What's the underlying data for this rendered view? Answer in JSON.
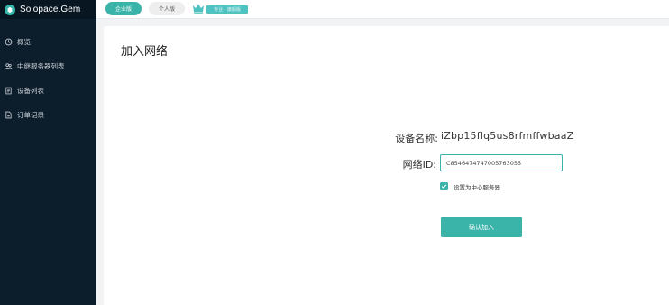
{
  "brand": {
    "name": "Solopace.Gem",
    "icon": "logo-icon"
  },
  "sidebar": {
    "items": [
      {
        "label": "概览",
        "icon": "dashboard-icon"
      },
      {
        "label": "中继服务器列表",
        "icon": "server-cluster-icon"
      },
      {
        "label": "设备列表",
        "icon": "device-list-icon"
      },
      {
        "label": "订单记录",
        "icon": "order-record-icon"
      }
    ]
  },
  "topbar": {
    "enterprise_label": "企业版",
    "personal_label": "个人版",
    "edition_badge": "专业 · 旗舰版",
    "crown_icon": "crown-icon"
  },
  "page": {
    "title": "加入网络",
    "device_name_label": "设备名称:",
    "device_name_value": "iZbp15flq5us8rfmffwbaaZ",
    "network_id_label": "网络ID:",
    "network_id_value": "C8546474747005763055",
    "center_server_label": "设置为中心服务器",
    "center_server_checked": true,
    "confirm_label": "确认加入"
  },
  "colors": {
    "accent": "#3ab3a9",
    "sidebar_bg": "#0c1d2b",
    "brand_bg": "#081621"
  }
}
